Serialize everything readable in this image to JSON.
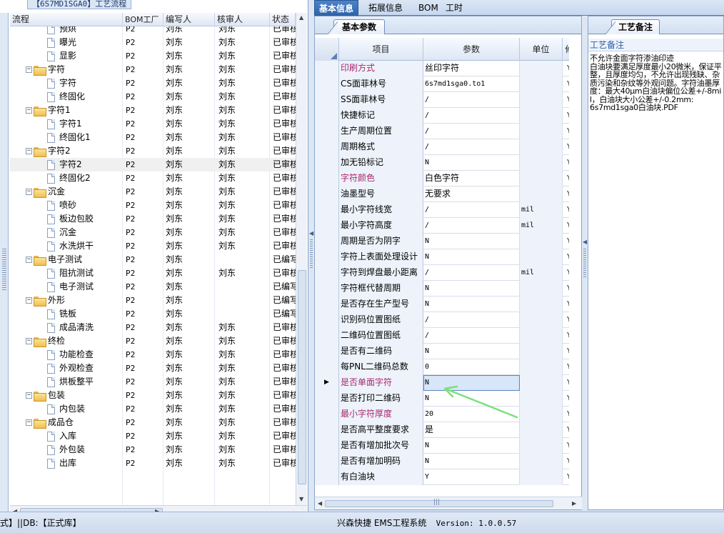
{
  "left_panel": {
    "title": "【6S7MD1SGA0】工艺流程",
    "columns": [
      "流程",
      "BOM工厂",
      "编写人",
      "核审人",
      "状态"
    ],
    "rows": [
      {
        "name": "预烘",
        "level": 2,
        "type": "doc",
        "bom": "P2",
        "writer": "刘东",
        "reviewer": "刘东",
        "status": "已审核"
      },
      {
        "name": "曝光",
        "level": 2,
        "type": "doc",
        "bom": "P2",
        "writer": "刘东",
        "reviewer": "刘东",
        "status": "已审核"
      },
      {
        "name": "显影",
        "level": 2,
        "type": "doc",
        "bom": "P2",
        "writer": "刘东",
        "reviewer": "刘东",
        "status": "已审核"
      },
      {
        "name": "字符",
        "level": 1,
        "type": "folder",
        "bom": "P2",
        "writer": "刘东",
        "reviewer": "刘东",
        "status": "已审核"
      },
      {
        "name": "字符",
        "level": 2,
        "type": "doc",
        "bom": "P2",
        "writer": "刘东",
        "reviewer": "刘东",
        "status": "已审核"
      },
      {
        "name": "终固化",
        "level": 2,
        "type": "doc",
        "bom": "P2",
        "writer": "刘东",
        "reviewer": "刘东",
        "status": "已审核"
      },
      {
        "name": "字符1",
        "level": 1,
        "type": "folder",
        "bom": "P2",
        "writer": "刘东",
        "reviewer": "刘东",
        "status": "已审核"
      },
      {
        "name": "字符1",
        "level": 2,
        "type": "doc",
        "bom": "P2",
        "writer": "刘东",
        "reviewer": "刘东",
        "status": "已审核"
      },
      {
        "name": "终固化1",
        "level": 2,
        "type": "doc",
        "bom": "P2",
        "writer": "刘东",
        "reviewer": "刘东",
        "status": "已审核"
      },
      {
        "name": "字符2",
        "level": 1,
        "type": "folder",
        "bom": "P2",
        "writer": "刘东",
        "reviewer": "刘东",
        "status": "已审核"
      },
      {
        "name": "字符2",
        "level": 2,
        "type": "doc",
        "bom": "P2",
        "writer": "刘东",
        "reviewer": "刘东",
        "status": "已审核",
        "selected": true
      },
      {
        "name": "终固化2",
        "level": 2,
        "type": "doc",
        "bom": "P2",
        "writer": "刘东",
        "reviewer": "刘东",
        "status": "已审核"
      },
      {
        "name": "沉金",
        "level": 1,
        "type": "folder",
        "bom": "P2",
        "writer": "刘东",
        "reviewer": "刘东",
        "status": "已审核"
      },
      {
        "name": "喷砂",
        "level": 2,
        "type": "doc",
        "bom": "P2",
        "writer": "刘东",
        "reviewer": "刘东",
        "status": "已审核"
      },
      {
        "name": "板边包胶",
        "level": 2,
        "type": "doc",
        "bom": "P2",
        "writer": "刘东",
        "reviewer": "刘东",
        "status": "已审核"
      },
      {
        "name": "沉金",
        "level": 2,
        "type": "doc",
        "bom": "P2",
        "writer": "刘东",
        "reviewer": "刘东",
        "status": "已审核"
      },
      {
        "name": "水洗烘干",
        "level": 2,
        "type": "doc",
        "bom": "P2",
        "writer": "刘东",
        "reviewer": "刘东",
        "status": "已审核"
      },
      {
        "name": "电子测试",
        "level": 1,
        "type": "folder",
        "bom": "P2",
        "writer": "刘东",
        "reviewer": "",
        "status": "已编写"
      },
      {
        "name": "阻抗测试",
        "level": 2,
        "type": "doc",
        "bom": "P2",
        "writer": "刘东",
        "reviewer": "刘东",
        "status": "已审核"
      },
      {
        "name": "电子测试",
        "level": 2,
        "type": "doc",
        "bom": "P2",
        "writer": "刘东",
        "reviewer": "",
        "status": "已编写"
      },
      {
        "name": "外形",
        "level": 1,
        "type": "folder",
        "bom": "P2",
        "writer": "刘东",
        "reviewer": "",
        "status": "已编写"
      },
      {
        "name": "铣板",
        "level": 2,
        "type": "doc",
        "bom": "P2",
        "writer": "刘东",
        "reviewer": "",
        "status": "已编写"
      },
      {
        "name": "成品清洗",
        "level": 2,
        "type": "doc",
        "bom": "P2",
        "writer": "刘东",
        "reviewer": "刘东",
        "status": "已审核"
      },
      {
        "name": "终检",
        "level": 1,
        "type": "folder",
        "bom": "P2",
        "writer": "刘东",
        "reviewer": "刘东",
        "status": "已审核"
      },
      {
        "name": "功能检查",
        "level": 2,
        "type": "doc",
        "bom": "P2",
        "writer": "刘东",
        "reviewer": "刘东",
        "status": "已审核"
      },
      {
        "name": "外观检查",
        "level": 2,
        "type": "doc",
        "bom": "P2",
        "writer": "刘东",
        "reviewer": "刘东",
        "status": "已审核"
      },
      {
        "name": "烘板整平",
        "level": 2,
        "type": "doc",
        "bom": "P2",
        "writer": "刘东",
        "reviewer": "刘东",
        "status": "已审核"
      },
      {
        "name": "包装",
        "level": 1,
        "type": "folder",
        "bom": "P2",
        "writer": "刘东",
        "reviewer": "刘东",
        "status": "已审核"
      },
      {
        "name": "内包装",
        "level": 2,
        "type": "doc",
        "bom": "P2",
        "writer": "刘东",
        "reviewer": "刘东",
        "status": "已审核"
      },
      {
        "name": "成品仓",
        "level": 1,
        "type": "folder",
        "bom": "P2",
        "writer": "刘东",
        "reviewer": "刘东",
        "status": "已审核"
      },
      {
        "name": "入库",
        "level": 2,
        "type": "doc",
        "bom": "P2",
        "writer": "刘东",
        "reviewer": "刘东",
        "status": "已审核"
      },
      {
        "name": "外包装",
        "level": 2,
        "type": "doc",
        "bom": "P2",
        "writer": "刘东",
        "reviewer": "刘东",
        "status": "已审核"
      },
      {
        "name": "出库",
        "level": 2,
        "type": "doc",
        "bom": "P2",
        "writer": "刘东",
        "reviewer": "刘东",
        "status": "已审核"
      }
    ]
  },
  "top_tabs": [
    "基本信息",
    "拓展信息",
    "BOM",
    "工时"
  ],
  "params": {
    "sub_tab": "基本参数",
    "columns": [
      "项目",
      "参数",
      "单位",
      "修"
    ],
    "rows": [
      {
        "name": "印刷方式",
        "value": "丝印字符",
        "unit": "",
        "flag": "Y",
        "highlight": true
      },
      {
        "name": "CS面菲林号",
        "value": "6s7md1sga0.to1",
        "unit": "",
        "flag": "Y"
      },
      {
        "name": "SS面菲林号",
        "value": "/",
        "unit": "",
        "flag": "Y"
      },
      {
        "name": "快捷标记",
        "value": "/",
        "unit": "",
        "flag": "Y"
      },
      {
        "name": "生产周期位置",
        "value": "/",
        "unit": "",
        "flag": "Y"
      },
      {
        "name": "周期格式",
        "value": "/",
        "unit": "",
        "flag": "Y"
      },
      {
        "name": "加无铅标记",
        "value": "N",
        "unit": "",
        "flag": "Y"
      },
      {
        "name": "字符颜色",
        "value": "白色字符",
        "unit": "",
        "flag": "Y",
        "highlight": true
      },
      {
        "name": "油墨型号",
        "value": "无要求",
        "unit": "",
        "flag": "Y"
      },
      {
        "name": "最小字符线宽",
        "value": "/",
        "unit": "mil",
        "flag": "Y"
      },
      {
        "name": "最小字符高度",
        "value": "/",
        "unit": "mil",
        "flag": "Y"
      },
      {
        "name": "周期是否为阴字",
        "value": "N",
        "unit": "",
        "flag": "Y"
      },
      {
        "name": "字符上表面处理设计",
        "value": "N",
        "unit": "",
        "flag": "Y"
      },
      {
        "name": "字符到焊盘最小距离",
        "value": "/",
        "unit": "mil",
        "flag": "Y"
      },
      {
        "name": "字符框代替周期",
        "value": "N",
        "unit": "",
        "flag": "Y"
      },
      {
        "name": "是否存在生产型号",
        "value": "N",
        "unit": "",
        "flag": "Y"
      },
      {
        "name": "识别码位置图纸",
        "value": "/",
        "unit": "",
        "flag": "Y"
      },
      {
        "name": "二维码位置图纸",
        "value": "/",
        "unit": "",
        "flag": "Y"
      },
      {
        "name": "是否有二维码",
        "value": "N",
        "unit": "",
        "flag": "Y"
      },
      {
        "name": "每PNL二维码总数",
        "value": "0",
        "unit": "",
        "flag": "Y"
      },
      {
        "name": "是否单面字符",
        "value": "N",
        "unit": "",
        "flag": "Y",
        "highlight": true,
        "current": true
      },
      {
        "name": "是否打印二维码",
        "value": "N",
        "unit": "",
        "flag": "Y"
      },
      {
        "name": "最小字符厚度",
        "value": "20",
        "unit": "",
        "flag": "Y",
        "highlight": true
      },
      {
        "name": "是否高平整度要求",
        "value": "是",
        "unit": "",
        "flag": "Y"
      },
      {
        "name": "是否有增加批次号",
        "value": "N",
        "unit": "",
        "flag": "Y"
      },
      {
        "name": "是否有增加明码",
        "value": "N",
        "unit": "",
        "flag": "Y"
      },
      {
        "name": "有白油块",
        "value": "Y",
        "unit": "",
        "flag": "Y"
      }
    ]
  },
  "remarks": {
    "tab": "工艺备注",
    "header": "工艺备注",
    "text": "不允许金面字符渗油印迹\n白油块要满足厚度最小20微米，保证平整，且厚度均匀，不允许出现残缺、杂质污染和杂纹等外观问题。字符油墨厚度：最大40μm白油块偏位公差+/-8mil，白油块大小公差+/-0.2mm:\n6s7md1sga0白油块.PDF"
  },
  "status": {
    "left": "式】||DB:【正式库】",
    "app": "兴森快捷 EMS工程系统",
    "version": "Version: 1.0.0.57"
  },
  "colors": {
    "highlight_name": "#a8276e",
    "active_tab": "#2f65aa",
    "annotation_arrow": "#7be07b"
  }
}
